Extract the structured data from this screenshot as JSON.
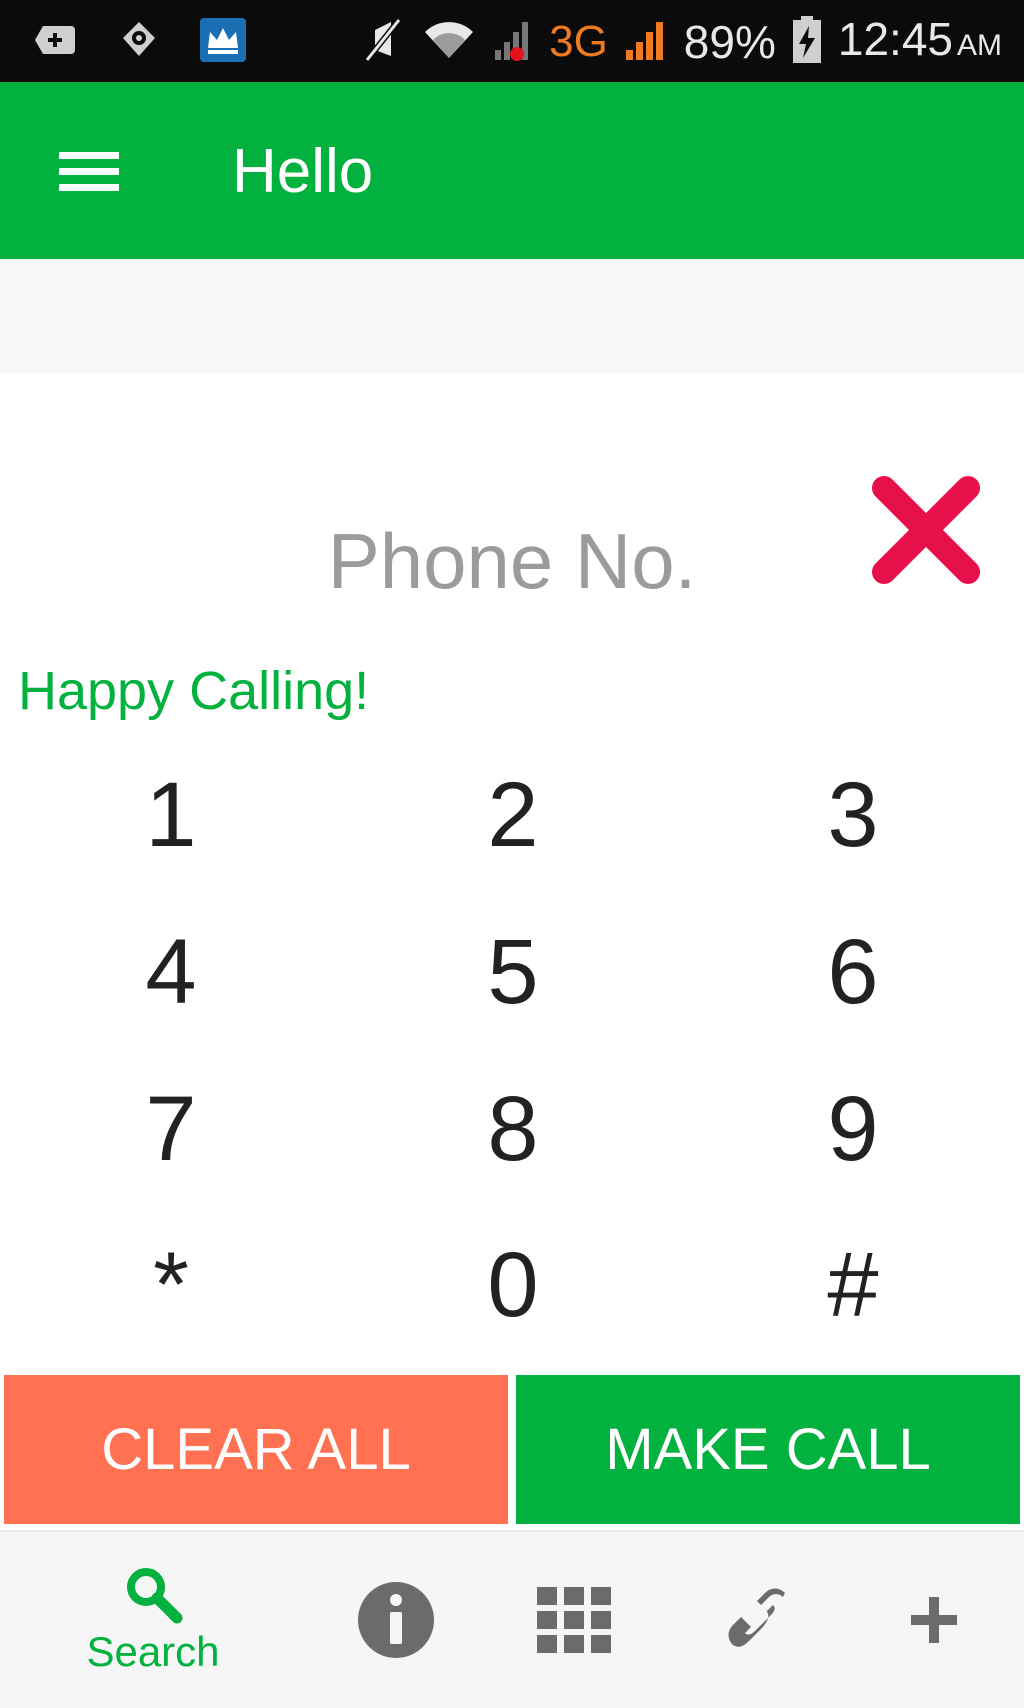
{
  "status_bar": {
    "network_type": "3G",
    "battery": "89%",
    "time": "12:45",
    "ampm": "AM"
  },
  "app_bar": {
    "title": "Hello"
  },
  "dialer": {
    "phone_placeholder": "Phone No.",
    "phone_value": "",
    "greeting": "Happy Calling!",
    "keys": [
      "1",
      "2",
      "3",
      "4",
      "5",
      "6",
      "7",
      "8",
      "9",
      "*",
      "0",
      "#"
    ]
  },
  "actions": {
    "clear_label": "CLEAR ALL",
    "call_label": "MAKE CALL"
  },
  "bottom_nav": {
    "items": [
      {
        "label": "Search",
        "icon": "search-icon",
        "active": true
      },
      {
        "label": "",
        "icon": "info-icon",
        "active": false
      },
      {
        "label": "",
        "icon": "grid-icon",
        "active": false
      },
      {
        "label": "",
        "icon": "phone-icon",
        "active": false
      },
      {
        "label": "",
        "icon": "plus-icon",
        "active": false
      }
    ]
  },
  "colors": {
    "primary_green": "#03b13e",
    "clear_orange": "#ff7151",
    "clear_x_red": "#e8104a",
    "nav_gray": "#6b6b6b"
  }
}
